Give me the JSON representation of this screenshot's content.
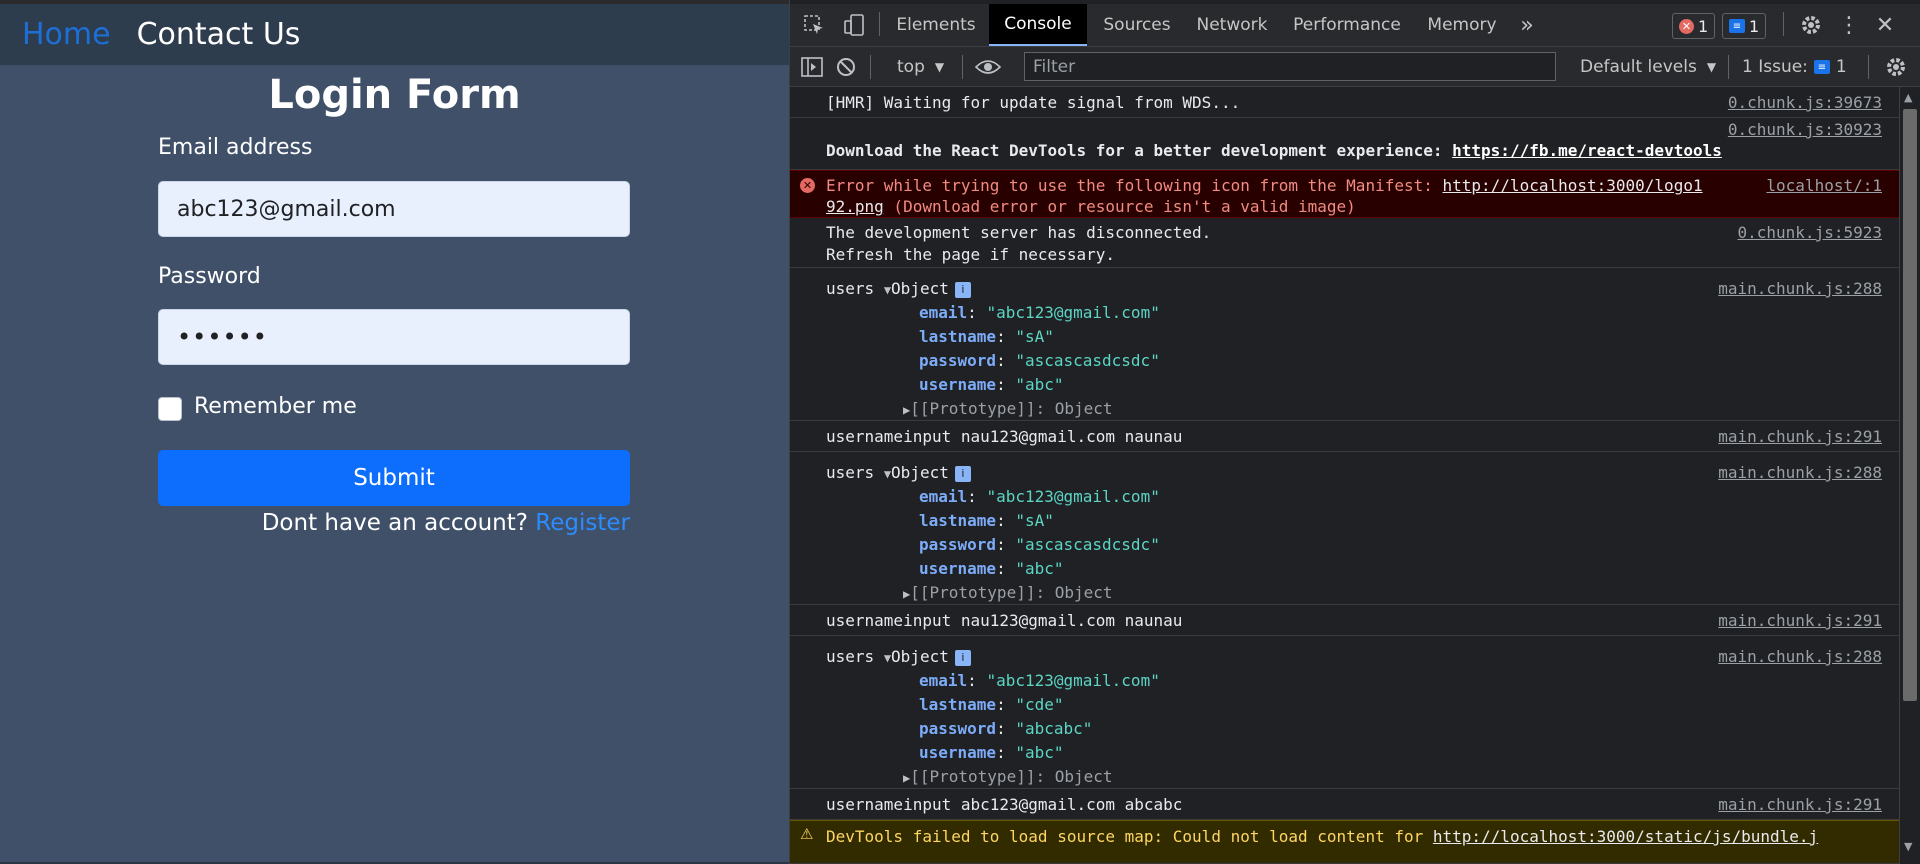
{
  "app": {
    "nav": {
      "home": "Home",
      "contact": "Contact Us"
    },
    "title": "Login Form",
    "email_label": "Email address",
    "email_value": "abc123@gmail.com",
    "password_label": "Password",
    "password_value": "••••••",
    "remember_label": "Remember me",
    "submit_label": "Submit",
    "register_prompt": "Dont have an account?",
    "register_link": "Register"
  },
  "devtools": {
    "tabs": [
      "Elements",
      "Console",
      "Sources",
      "Network",
      "Performance",
      "Memory"
    ],
    "more_tabs": "»",
    "error_count": "1",
    "message_count": "1",
    "context": "top",
    "filter_placeholder": "Filter",
    "levels": "Default levels",
    "issues_label": "1 Issue:",
    "issues_count": "1",
    "icons": [
      "inspect-icon",
      "device-toolbar-icon",
      "sidebar-icon",
      "clear-icon",
      "eye-icon",
      "settings-icon",
      "kebab-icon",
      "close-icon"
    ]
  },
  "console": {
    "hmr": {
      "text": "[HMR] Waiting for update signal from WDS...",
      "src": "0.chunk.js:39673"
    },
    "react": {
      "src": "0.chunk.js:30923",
      "text": "Download the React DevTools for a better development experience: ",
      "link": "https://fb.me/react-devtools"
    },
    "error": {
      "text1": "Error while trying to use the following icon from the Manifest: ",
      "link1": "http://localhost:3000/logo1",
      "link2": "92.png",
      "text2": " (Download error or resource isn't a valid image)",
      "src": "localhost/:1"
    },
    "disconnect": {
      "line1": "The development server has disconnected.",
      "line2": "Refresh the page if necessary.",
      "src": "0.chunk.js:5923"
    },
    "objects": [
      {
        "label": "users",
        "type": "Object",
        "src": "main.chunk.js:288",
        "email": "\"abc123@gmail.com\"",
        "lastname": "\"sA\"",
        "password": "\"ascascasdcsdc\"",
        "username": "\"abc\""
      },
      {
        "label": "users",
        "type": "Object",
        "src": "main.chunk.js:288",
        "email": "\"abc123@gmail.com\"",
        "lastname": "\"sA\"",
        "password": "\"ascascasdcsdc\"",
        "username": "\"abc\""
      },
      {
        "label": "users",
        "type": "Object",
        "src": "main.chunk.js:288",
        "email": "\"abc123@gmail.com\"",
        "lastname": "\"cde\"",
        "password": "\"abcabc\"",
        "username": "\"abc\""
      }
    ],
    "prototype": "[[Prototype]]: Object",
    "inputs": [
      {
        "text": "usernameinput nau123@gmail.com naunau",
        "src": "main.chunk.js:291"
      },
      {
        "text": "usernameinput nau123@gmail.com naunau",
        "src": "main.chunk.js:291"
      },
      {
        "text": "usernameinput abc123@gmail.com abcabc",
        "src": "main.chunk.js:291"
      }
    ],
    "warning": {
      "text": "DevTools failed to load source map: Could not load content for ",
      "link": "http://localhost:3000/static/js/bundle.j"
    }
  }
}
